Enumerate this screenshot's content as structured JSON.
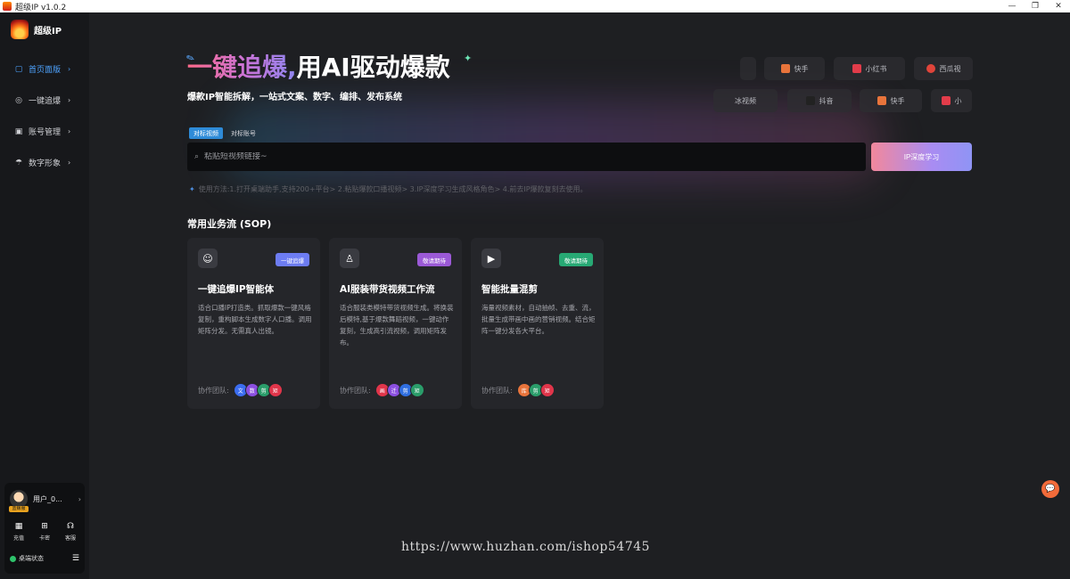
{
  "window": {
    "title": "超级IP v1.0.2",
    "controls": [
      "—",
      "❐",
      "✕"
    ]
  },
  "sidebar": {
    "brand": "超级IP",
    "items": [
      {
        "label": "首页面版",
        "icon": "home-icon",
        "active": true
      },
      {
        "label": "一键追爆",
        "icon": "globe-icon",
        "active": false
      },
      {
        "label": "账号管理",
        "icon": "account-icon",
        "active": false
      },
      {
        "label": "数字形象",
        "icon": "umbrella-icon",
        "active": false
      }
    ],
    "user": {
      "name": "用户_0...",
      "badge": "蓝鲸服",
      "actions": [
        {
          "label": "充值",
          "icon": "grid-icon"
        },
        {
          "label": "卡密",
          "icon": "gift-icon"
        },
        {
          "label": "客服",
          "icon": "headset-icon"
        }
      ],
      "status": "桌端状态"
    }
  },
  "hero": {
    "headline_gradient": "一键追爆,",
    "headline_plain": "用AI驱动爆款",
    "subtitle": "爆款IP智能拆解，一站式文案、数字、编排、发布系统"
  },
  "platforms_row1": [
    {
      "label": "快手",
      "color": "#e8743b"
    },
    {
      "label": "小红书",
      "color": "#e23c4a"
    },
    {
      "label": "西瓜视",
      "color": "#e0443a"
    }
  ],
  "platforms_row2": [
    {
      "label": "冰视频",
      "color": "#3a3b40"
    },
    {
      "label": "抖音",
      "color": "#222"
    },
    {
      "label": "快手",
      "color": "#e8743b"
    },
    {
      "label": "小",
      "color": "#e23c4a"
    }
  ],
  "search": {
    "tabs": [
      "对标视频",
      "对标账号"
    ],
    "placeholder": "粘贴短视频链接~",
    "button": "IP深度学习",
    "usage": "使用方法:1.打开桌端助手,支持200+平台> 2.粘贴爆款口播视频> 3.IP深度学习生成风格角色> 4.前去IP爆款复刻去使用。"
  },
  "sop": {
    "title": "常用业务流 (SOP)",
    "cards": [
      {
        "icon": "robot-icon",
        "badge": "一键追爆",
        "badge_color": "#6d7cf2",
        "title": "一键追爆IP智能体",
        "desc": "适合口播IP打造类。抓取爆款一键风格复制，重构脚本生成数字人口播。调用矩阵分发。无需真人出镜。",
        "team_label": "协作团队:",
        "members": [
          {
            "text": "文",
            "color": "#3b6df0"
          },
          {
            "text": "数",
            "color": "#8b4fe0"
          },
          {
            "text": "剪",
            "color": "#2a9d6a"
          },
          {
            "text": "矩",
            "color": "#e0354a"
          }
        ]
      },
      {
        "icon": "shirt-icon",
        "badge": "敬请期待",
        "badge_color": "#9b59d6",
        "title": "AI服装带货视频工作流",
        "desc": "适合服装类模特带货视频生成。将换装后模特,基于爆款舞蹈视频，一键动作复刻，生成高引流视频，调用矩阵发布。",
        "team_label": "协作团队:",
        "members": [
          {
            "text": "画",
            "color": "#e0354a"
          },
          {
            "text": "迁",
            "color": "#8b4fe0"
          },
          {
            "text": "剪",
            "color": "#2f6ee0"
          },
          {
            "text": "矩",
            "color": "#2a9d6a"
          }
        ]
      },
      {
        "icon": "video-icon",
        "badge": "敬请期待",
        "badge_color": "#27a974",
        "title": "智能批量混剪",
        "desc": "海量视频素材，自动抽帧、去重、流，批量生成带画中画的营销视频。结合矩阵一键分发各大平台。",
        "team_label": "协作团队:",
        "members": [
          {
            "text": "库",
            "color": "#e8743b"
          },
          {
            "text": "剪",
            "color": "#2a9d6a"
          },
          {
            "text": "矩",
            "color": "#e0354a"
          }
        ]
      }
    ]
  },
  "watermark": "https://www.huzhan.com/ishop54745",
  "float_button_icon": "chat-icon"
}
